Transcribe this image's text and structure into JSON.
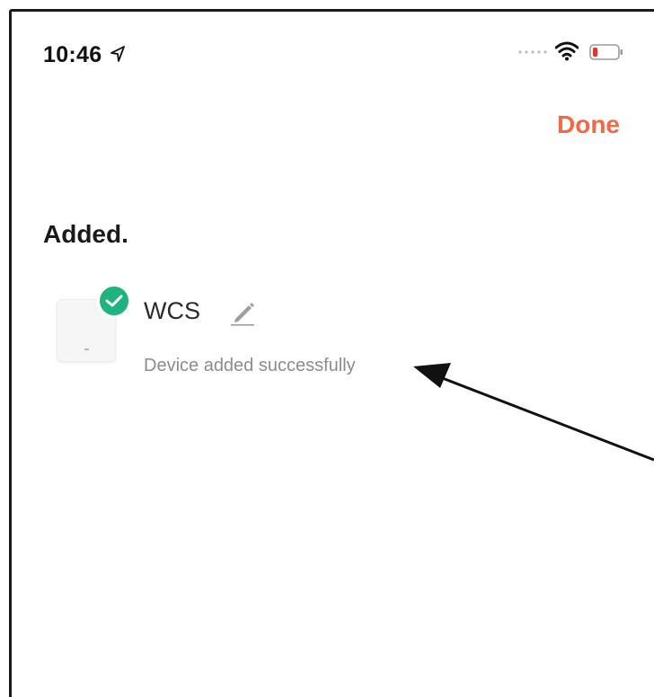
{
  "status_bar": {
    "time": "10:46",
    "icons": [
      "location-arrow-icon",
      "signal-dots-icon",
      "wifi-icon",
      "battery-low-icon"
    ],
    "battery_color": "#e5362e"
  },
  "header": {
    "done_label": "Done",
    "accent_color": "#ef6a45"
  },
  "main": {
    "section_title": "Added.",
    "device": {
      "name": "WCS",
      "status": "Device added successfully",
      "badge_icon": "check-circle-icon",
      "badge_color": "#1fb37f",
      "edit_icon": "pencil-icon"
    }
  }
}
